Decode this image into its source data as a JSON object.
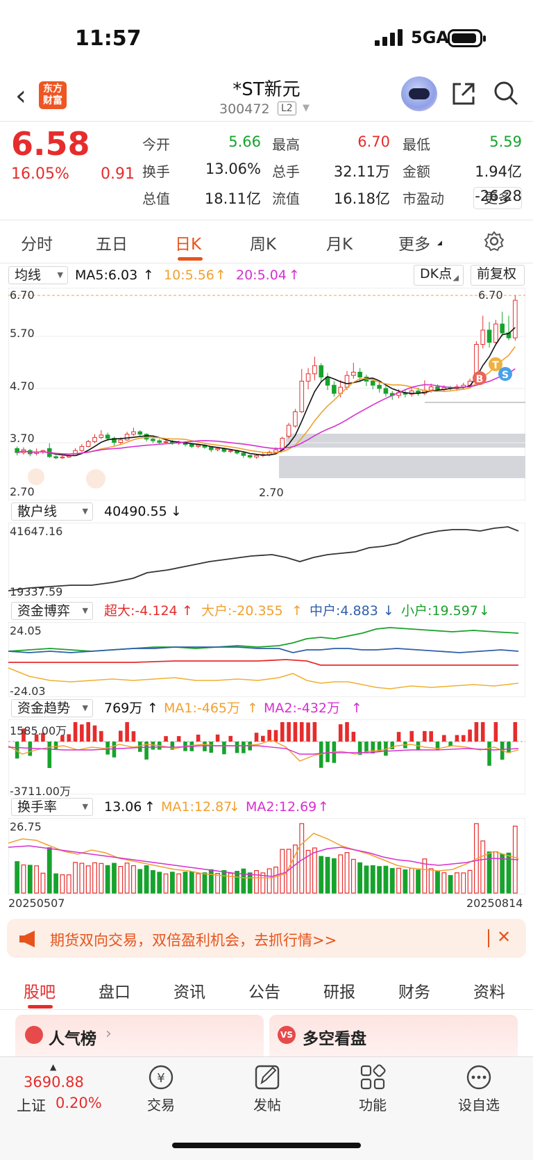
{
  "status_bar": {
    "time": "11:57",
    "network": "5GA"
  },
  "header": {
    "back_icon": "chevron-left-icon",
    "logo_text": [
      "东方",
      "财富"
    ],
    "stock_name": "*ST新元",
    "stock_code": "300472",
    "level": "L2"
  },
  "quote": {
    "price": "6.58",
    "change_pct": "16.05%",
    "change": "0.91",
    "rows": [
      [
        {
          "label": "今开",
          "value": "5.66",
          "color": "green"
        },
        {
          "label": "最高",
          "value": "6.70",
          "color": "red"
        },
        {
          "label": "最低",
          "value": "5.59",
          "color": "green"
        }
      ],
      [
        {
          "label": "换手",
          "value": "13.06%",
          "color": "black"
        },
        {
          "label": "总手",
          "value": "32.11万",
          "color": "black"
        },
        {
          "label": "金额",
          "value": "1.94亿",
          "color": "black"
        }
      ],
      [
        {
          "label": "总值",
          "value": "18.11亿",
          "color": "black"
        },
        {
          "label": "流值",
          "value": "16.18亿",
          "color": "black"
        },
        {
          "label": "市盈动",
          "value": "-26.28",
          "color": "black"
        }
      ]
    ],
    "more_button": "更多"
  },
  "tabs": [
    "分时",
    "五日",
    "日K",
    "周K",
    "月K",
    "更多"
  ],
  "active_tab": "日K",
  "kline": {
    "indicator_select": "均线",
    "ma5": "MA5:6.03",
    "ma10": "10:5.56",
    "ma20": "20:5.04",
    "dk_button": "DK点",
    "adjust_button": "前复权",
    "axis": [
      "6.70",
      "5.70",
      "4.70",
      "3.70",
      "2.70"
    ],
    "high_marker": "6.70",
    "low_marker": "2.70",
    "signal_b": "B",
    "signal_t": "T",
    "signal_s": "S"
  },
  "retail_panel": {
    "select": "散户线",
    "value": "40490.55",
    "axis_top": "41647.16",
    "axis_bottom": "19337.59"
  },
  "fund_game_panel": {
    "select": "资金博弈",
    "super": "超大:-4.124",
    "large": "大户:-20.355",
    "medium": "中户:4.883",
    "small": "小户:19.597",
    "axis_top": "24.05",
    "axis_bottom": "-24.03"
  },
  "fund_trend_panel": {
    "select": "资金趋势",
    "value": "769万",
    "ma1": "MA1:-465万",
    "ma2": "MA2:-432万",
    "axis_top": "1585.00万",
    "axis_bottom": "-3711.00万"
  },
  "turnover_panel": {
    "select": "换手率",
    "value": "13.06",
    "ma1": "MA1:12.87",
    "ma2": "MA2:12.69",
    "axis_top": "26.75",
    "date_start": "20250507",
    "date_end": "20250814"
  },
  "banner": {
    "text": "期货双向交易，双倍盈利机会，去抓行情>>"
  },
  "bottom_tabs": [
    "股吧",
    "盘口",
    "资讯",
    "公告",
    "研报",
    "财务",
    "资料"
  ],
  "cards": {
    "popular": "人气榜",
    "bull_bear": "多空看盘"
  },
  "bottom_nav": {
    "index_value": "3690.88",
    "index_name": "上证",
    "index_pct": "0.20%",
    "items": [
      "交易",
      "发帖",
      "功能",
      "设自选"
    ]
  },
  "chart_data": {
    "type": "candlestick",
    "title": "",
    "xlabel": "",
    "ylabel": "",
    "x_range": [
      "20250507",
      "20250814"
    ],
    "ylim": [
      2.7,
      6.7
    ],
    "candles": [
      {
        "o": 2.95,
        "c": 2.85,
        "h": 3.0,
        "l": 2.78
      },
      {
        "o": 2.85,
        "c": 2.92,
        "h": 2.98,
        "l": 2.8
      },
      {
        "o": 2.9,
        "c": 2.82,
        "h": 2.94,
        "l": 2.76
      },
      {
        "o": 2.83,
        "c": 2.86,
        "h": 2.95,
        "l": 2.78
      },
      {
        "o": 2.86,
        "c": 2.9,
        "h": 2.92,
        "l": 2.82
      },
      {
        "o": 2.95,
        "c": 2.75,
        "h": 3.08,
        "l": 2.72
      },
      {
        "o": 2.75,
        "c": 2.72,
        "h": 2.78,
        "l": 2.69
      },
      {
        "o": 2.72,
        "c": 2.74,
        "h": 2.78,
        "l": 2.7
      },
      {
        "o": 2.74,
        "c": 2.77,
        "h": 2.8,
        "l": 2.72
      },
      {
        "o": 2.78,
        "c": 2.9,
        "h": 2.96,
        "l": 2.76
      },
      {
        "o": 2.9,
        "c": 3.0,
        "h": 3.06,
        "l": 2.86
      },
      {
        "o": 3.0,
        "c": 3.12,
        "h": 3.16,
        "l": 2.98
      },
      {
        "o": 3.12,
        "c": 3.22,
        "h": 3.3,
        "l": 3.08
      },
      {
        "o": 3.22,
        "c": 3.28,
        "h": 3.4,
        "l": 3.18
      },
      {
        "o": 3.28,
        "c": 3.2,
        "h": 3.34,
        "l": 3.14
      },
      {
        "o": 3.2,
        "c": 3.1,
        "h": 3.24,
        "l": 3.02
      },
      {
        "o": 3.1,
        "c": 3.16,
        "h": 3.22,
        "l": 3.04
      },
      {
        "o": 3.16,
        "c": 3.3,
        "h": 3.36,
        "l": 3.14
      },
      {
        "o": 3.3,
        "c": 3.36,
        "h": 3.46,
        "l": 3.26
      },
      {
        "o": 3.36,
        "c": 3.3,
        "h": 3.4,
        "l": 3.24
      },
      {
        "o": 3.3,
        "c": 3.18,
        "h": 3.32,
        "l": 3.12
      },
      {
        "o": 3.18,
        "c": 3.14,
        "h": 3.22,
        "l": 3.08
      },
      {
        "o": 3.14,
        "c": 3.1,
        "h": 3.18,
        "l": 3.06
      },
      {
        "o": 3.1,
        "c": 3.12,
        "h": 3.16,
        "l": 3.06
      },
      {
        "o": 3.12,
        "c": 3.08,
        "h": 3.16,
        "l": 3.04
      },
      {
        "o": 3.08,
        "c": 3.1,
        "h": 3.14,
        "l": 3.04
      },
      {
        "o": 3.1,
        "c": 3.05,
        "h": 3.12,
        "l": 3.0
      },
      {
        "o": 3.05,
        "c": 3.0,
        "h": 3.08,
        "l": 2.96
      },
      {
        "o": 3.0,
        "c": 3.03,
        "h": 3.06,
        "l": 2.96
      },
      {
        "o": 3.03,
        "c": 2.98,
        "h": 3.05,
        "l": 2.94
      },
      {
        "o": 2.98,
        "c": 2.92,
        "h": 3.0,
        "l": 2.86
      },
      {
        "o": 2.92,
        "c": 2.95,
        "h": 2.98,
        "l": 2.88
      },
      {
        "o": 2.95,
        "c": 2.88,
        "h": 2.97,
        "l": 2.84
      },
      {
        "o": 2.88,
        "c": 2.9,
        "h": 2.94,
        "l": 2.84
      },
      {
        "o": 2.9,
        "c": 2.84,
        "h": 2.92,
        "l": 2.8
      },
      {
        "o": 2.84,
        "c": 2.78,
        "h": 2.86,
        "l": 2.72
      },
      {
        "o": 2.78,
        "c": 2.74,
        "h": 2.8,
        "l": 2.7
      },
      {
        "o": 2.74,
        "c": 2.78,
        "h": 2.82,
        "l": 2.7
      },
      {
        "o": 2.78,
        "c": 2.8,
        "h": 2.84,
        "l": 2.74
      },
      {
        "o": 2.8,
        "c": 2.86,
        "h": 2.9,
        "l": 2.76
      },
      {
        "o": 2.86,
        "c": 2.92,
        "h": 2.98,
        "l": 2.82
      },
      {
        "o": 2.92,
        "c": 3.2,
        "h": 3.24,
        "l": 2.9
      },
      {
        "o": 3.25,
        "c": 3.52,
        "h": 3.58,
        "l": 3.2
      },
      {
        "o": 3.5,
        "c": 3.85,
        "h": 3.92,
        "l": 3.46
      },
      {
        "o": 3.85,
        "c": 4.6,
        "h": 4.9,
        "l": 3.82
      },
      {
        "o": 4.6,
        "c": 4.78,
        "h": 4.92,
        "l": 4.4
      },
      {
        "o": 4.78,
        "c": 4.98,
        "h": 5.2,
        "l": 4.62
      },
      {
        "o": 4.98,
        "c": 4.7,
        "h": 5.04,
        "l": 4.58
      },
      {
        "o": 4.7,
        "c": 4.5,
        "h": 4.8,
        "l": 4.38
      },
      {
        "o": 4.5,
        "c": 4.3,
        "h": 4.6,
        "l": 4.22
      },
      {
        "o": 4.3,
        "c": 4.45,
        "h": 4.62,
        "l": 4.2
      },
      {
        "o": 4.45,
        "c": 4.74,
        "h": 4.85,
        "l": 4.38
      },
      {
        "o": 4.74,
        "c": 4.82,
        "h": 5.05,
        "l": 4.66
      },
      {
        "o": 4.82,
        "c": 4.7,
        "h": 4.92,
        "l": 4.58
      },
      {
        "o": 4.7,
        "c": 4.6,
        "h": 4.76,
        "l": 4.48
      },
      {
        "o": 4.6,
        "c": 4.5,
        "h": 4.68,
        "l": 4.4
      },
      {
        "o": 4.5,
        "c": 4.42,
        "h": 4.58,
        "l": 4.32
      },
      {
        "o": 4.42,
        "c": 4.3,
        "h": 4.48,
        "l": 4.22
      },
      {
        "o": 4.3,
        "c": 4.25,
        "h": 4.36,
        "l": 4.14
      },
      {
        "o": 4.25,
        "c": 4.32,
        "h": 4.4,
        "l": 4.18
      },
      {
        "o": 4.32,
        "c": 4.28,
        "h": 4.4,
        "l": 4.2
      },
      {
        "o": 4.28,
        "c": 4.36,
        "h": 4.44,
        "l": 4.22
      },
      {
        "o": 4.36,
        "c": 4.3,
        "h": 4.44,
        "l": 4.24
      },
      {
        "o": 4.3,
        "c": 4.38,
        "h": 4.62,
        "l": 4.26
      },
      {
        "o": 4.38,
        "c": 4.46,
        "h": 4.54,
        "l": 4.32
      },
      {
        "o": 4.46,
        "c": 4.4,
        "h": 4.52,
        "l": 4.34
      },
      {
        "o": 4.4,
        "c": 4.44,
        "h": 4.5,
        "l": 4.34
      },
      {
        "o": 4.44,
        "c": 4.42,
        "h": 4.48,
        "l": 4.36
      },
      {
        "o": 4.42,
        "c": 4.46,
        "h": 4.52,
        "l": 4.36
      },
      {
        "o": 4.46,
        "c": 4.5,
        "h": 4.56,
        "l": 4.4
      },
      {
        "o": 4.5,
        "c": 4.6,
        "h": 4.66,
        "l": 4.46
      },
      {
        "o": 4.6,
        "c": 5.5,
        "h": 5.58,
        "l": 4.56
      },
      {
        "o": 5.5,
        "c": 5.85,
        "h": 6.2,
        "l": 5.4
      },
      {
        "o": 5.85,
        "c": 5.55,
        "h": 6.05,
        "l": 5.42
      },
      {
        "o": 5.55,
        "c": 6.0,
        "h": 6.1,
        "l": 5.5
      },
      {
        "o": 6.0,
        "c": 5.78,
        "h": 6.3,
        "l": 5.7
      },
      {
        "o": 5.78,
        "c": 5.66,
        "h": 6.2,
        "l": 5.6
      },
      {
        "o": 5.66,
        "c": 6.58,
        "h": 6.7,
        "l": 5.59
      }
    ]
  }
}
